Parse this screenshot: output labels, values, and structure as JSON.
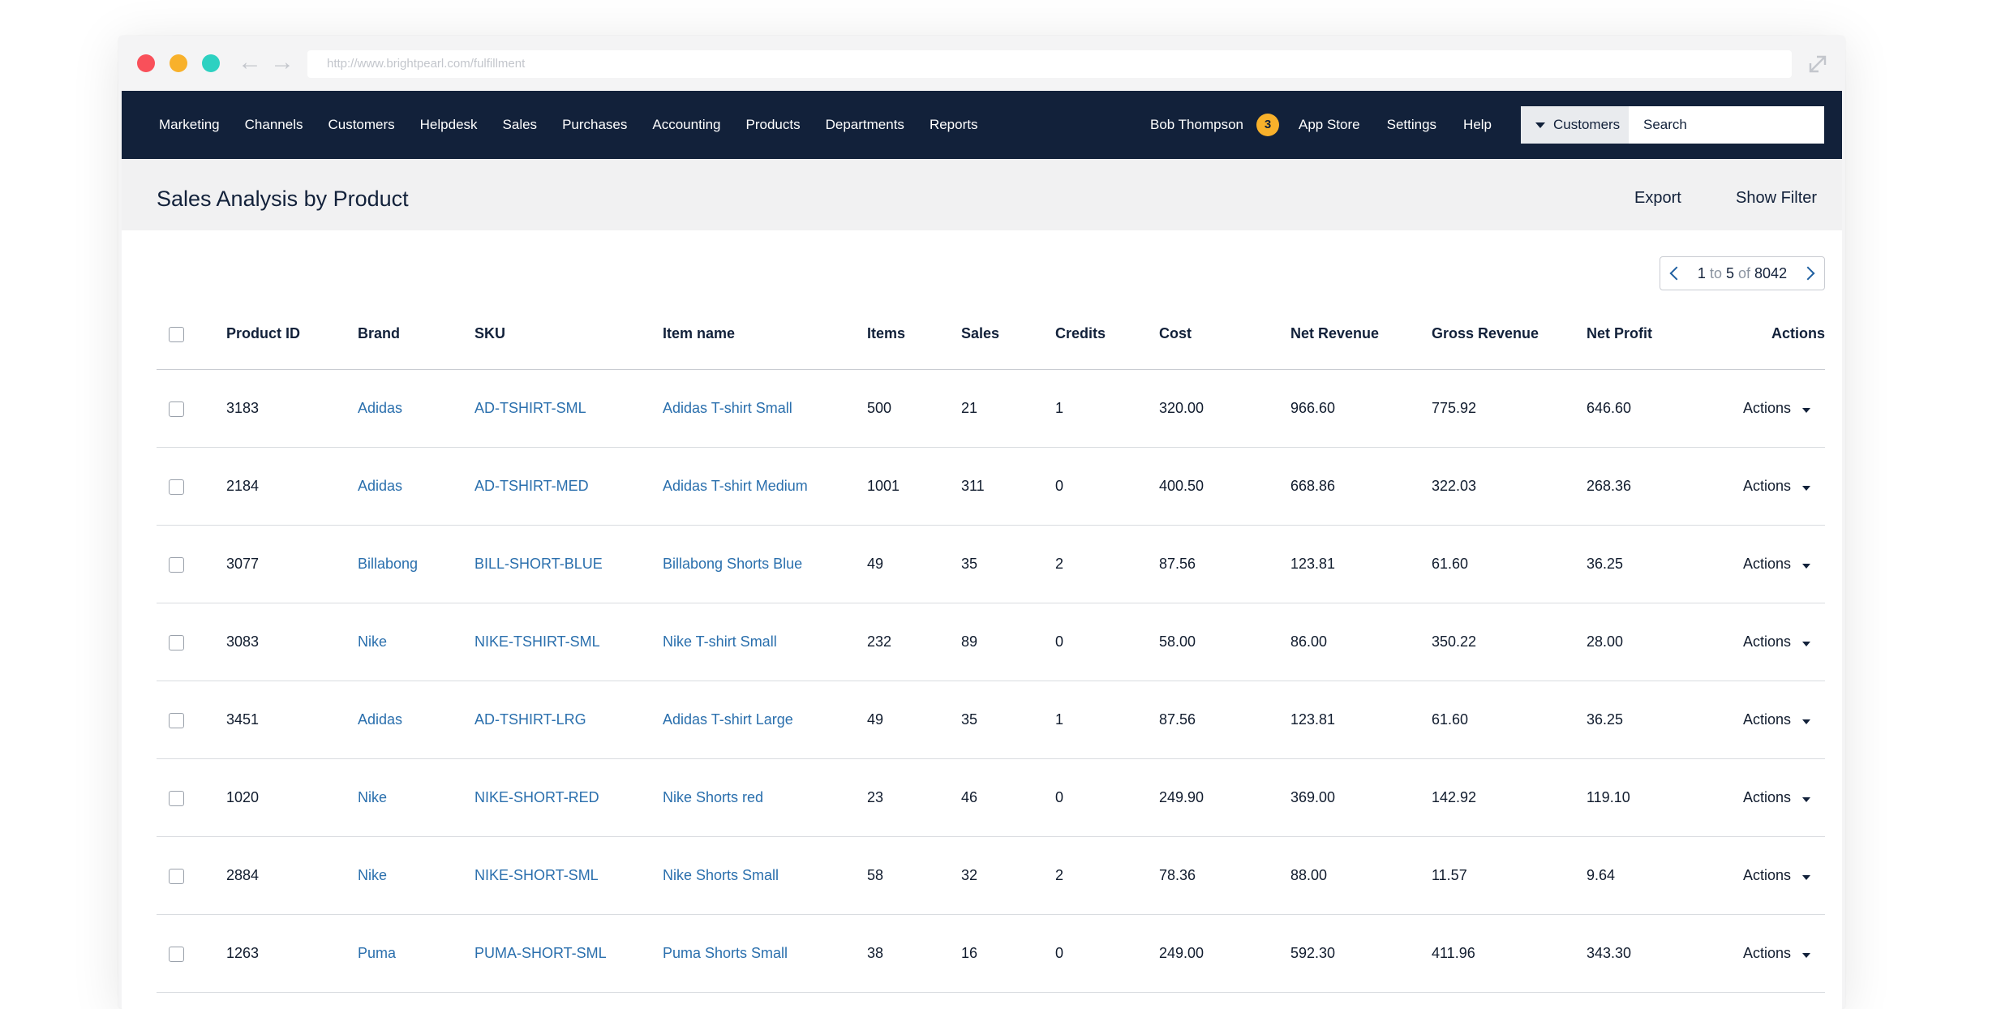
{
  "browser": {
    "url": "http://www.brightpearl.com/fulfillment"
  },
  "nav": {
    "items": [
      "Marketing",
      "Channels",
      "Customers",
      "Helpdesk",
      "Sales",
      "Purchases",
      "Accounting",
      "Products",
      "Departments",
      "Reports"
    ],
    "user_name": "Bob Thompson",
    "notification_count": "3",
    "right_items": [
      "App Store",
      "Settings",
      "Help"
    ],
    "search_scope": "Customers",
    "search_placeholder": "Search"
  },
  "page": {
    "title": "Sales Analysis by Product",
    "export_label": "Export",
    "filter_label": "Show Filter"
  },
  "pager": {
    "from": "1",
    "to_word": "to",
    "to": "5",
    "of_word": "of",
    "total": "8042"
  },
  "table": {
    "columns": [
      "Product ID",
      "Brand",
      "SKU",
      "Item name",
      "Items",
      "Sales",
      "Credits",
      "Cost",
      "Net Revenue",
      "Gross Revenue",
      "Net Profit",
      "Actions"
    ],
    "action_label": "Actions",
    "rows": [
      {
        "id": "3183",
        "brand": "Adidas",
        "sku": "AD-TSHIRT-SML",
        "name": "Adidas T-shirt Small",
        "items": "500",
        "sales": "21",
        "credits": "1",
        "cost": "320.00",
        "net_revenue": "966.60",
        "gross_revenue": "775.92",
        "net_profit": "646.60"
      },
      {
        "id": "2184",
        "brand": "Adidas",
        "sku": "AD-TSHIRT-MED",
        "name": "Adidas T-shirt Medium",
        "items": "1001",
        "sales": "311",
        "credits": "0",
        "cost": "400.50",
        "net_revenue": "668.86",
        "gross_revenue": "322.03",
        "net_profit": "268.36"
      },
      {
        "id": "3077",
        "brand": "Billabong",
        "sku": "BILL-SHORT-BLUE",
        "name": "Billabong Shorts Blue",
        "items": "49",
        "sales": "35",
        "credits": "2",
        "cost": "87.56",
        "net_revenue": "123.81",
        "gross_revenue": "61.60",
        "net_profit": "36.25"
      },
      {
        "id": "3083",
        "brand": "Nike",
        "sku": "NIKE-TSHIRT-SML",
        "name": "Nike T-shirt Small",
        "items": "232",
        "sales": "89",
        "credits": "0",
        "cost": "58.00",
        "net_revenue": "86.00",
        "gross_revenue": "350.22",
        "net_profit": "28.00"
      },
      {
        "id": "3451",
        "brand": "Adidas",
        "sku": "AD-TSHIRT-LRG",
        "name": "Adidas T-shirt Large",
        "items": "49",
        "sales": "35",
        "credits": "1",
        "cost": "87.56",
        "net_revenue": "123.81",
        "gross_revenue": "61.60",
        "net_profit": "36.25"
      },
      {
        "id": "1020",
        "brand": "Nike",
        "sku": "NIKE-SHORT-RED",
        "name": "Nike Shorts red",
        "items": "23",
        "sales": "46",
        "credits": "0",
        "cost": "249.90",
        "net_revenue": "369.00",
        "gross_revenue": "142.92",
        "net_profit": "119.10"
      },
      {
        "id": "2884",
        "brand": "Nike",
        "sku": "NIKE-SHORT-SML",
        "name": "Nike Shorts Small",
        "items": "58",
        "sales": "32",
        "credits": "2",
        "cost": "78.36",
        "net_revenue": "88.00",
        "gross_revenue": "11.57",
        "net_profit": "9.64"
      },
      {
        "id": "1263",
        "brand": "Puma",
        "sku": "PUMA-SHORT-SML",
        "name": "Puma Shorts Small",
        "items": "38",
        "sales": "16",
        "credits": "0",
        "cost": "249.00",
        "net_revenue": "592.30",
        "gross_revenue": "411.96",
        "net_profit": "343.30"
      }
    ]
  },
  "colors": {
    "nav_bg": "#12213a",
    "link": "#2a6fad",
    "badge": "#f8b12b"
  }
}
